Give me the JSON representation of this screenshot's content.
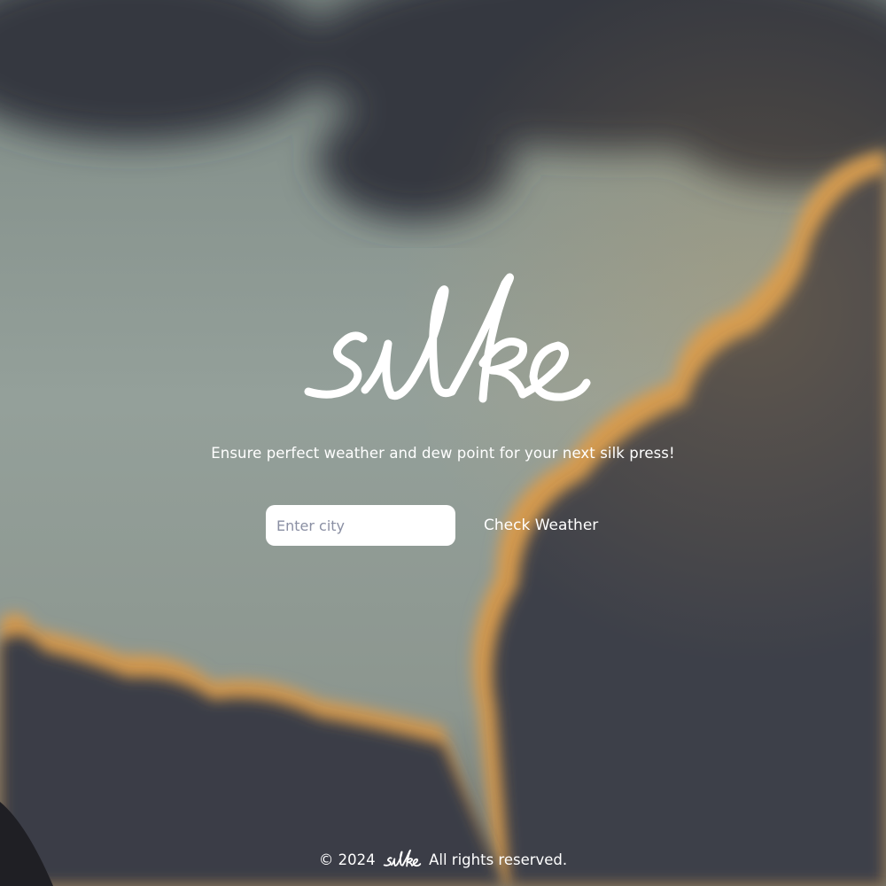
{
  "brand": {
    "name": "silke"
  },
  "tagline": "Ensure perfect weather and dew point for your next silk press!",
  "search": {
    "placeholder": "Enter city",
    "value": ""
  },
  "button": {
    "label": "Check Weather"
  },
  "footer": {
    "prefix": "© 2024",
    "suffix": "All rights reserved."
  },
  "colors": {
    "text": "#ffffff",
    "input_bg": "#ffffff",
    "placeholder": "#8a8fa3"
  }
}
